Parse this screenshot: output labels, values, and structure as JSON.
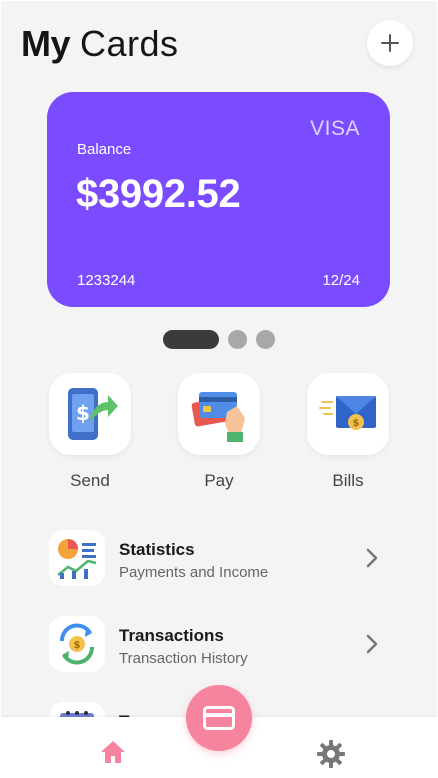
{
  "header": {
    "title_bold": "My",
    "title_light": "Cards"
  },
  "card": {
    "brand": "VISA",
    "balance_label": "Balance",
    "balance_value": "$3992.52",
    "number": "1233244",
    "expiry": "12/24",
    "color": "#7b4cff"
  },
  "carousel": {
    "pages": 3,
    "active_index": 0
  },
  "actions": [
    {
      "label": "Send",
      "icon": "send-money-icon"
    },
    {
      "label": "Pay",
      "icon": "card-payment-icon"
    },
    {
      "label": "Bills",
      "icon": "bill-envelope-icon"
    }
  ],
  "menu": [
    {
      "title": "Statistics",
      "subtitle": "Payments and Income",
      "icon": "statistics-icon"
    },
    {
      "title": "Transactions",
      "subtitle": "Transaction History",
      "icon": "transactions-icon"
    },
    {
      "title": "Tr",
      "subtitle": "",
      "icon": "calendar-icon"
    }
  ],
  "tabbar": {
    "items": [
      "home-icon",
      "card-icon",
      "settings-icon"
    ],
    "active": "home-icon",
    "accent": "#f7849f"
  }
}
